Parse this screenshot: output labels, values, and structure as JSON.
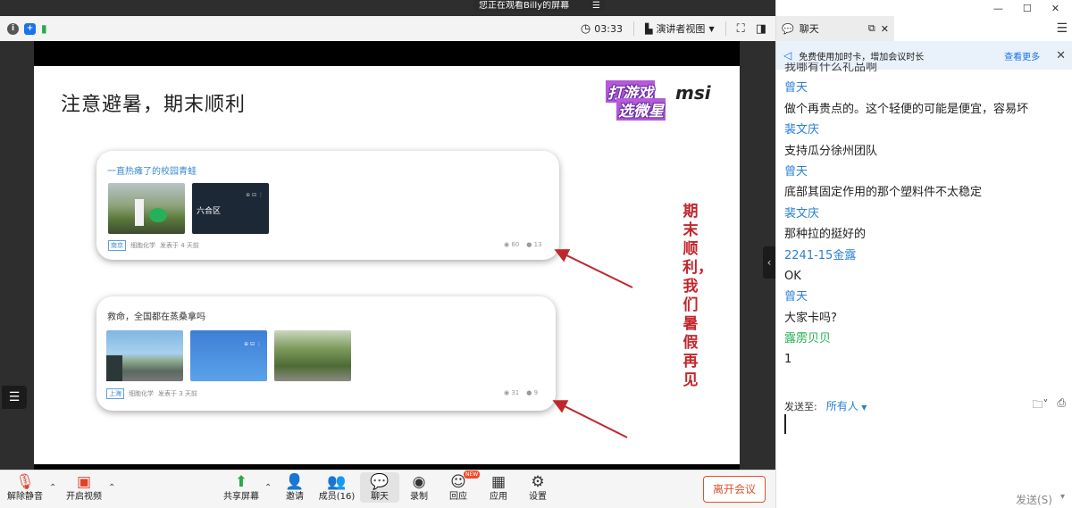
{
  "viewing_banner": "您正在观看Billy的屏幕",
  "topbar": {
    "timer": "03:33",
    "view_mode": "演讲者视图"
  },
  "slide": {
    "title": "注意避暑，期末顺利",
    "logo_game_line1": "打游戏",
    "logo_game_line2": "选微星",
    "logo_brand": "msi",
    "card1": {
      "title": "一直热瘫了的校园青蛙",
      "thumb_text": "六合区",
      "tag": "南京",
      "author": "细胞化学",
      "time": "发表于 4 天前",
      "views": "60",
      "comments": "13"
    },
    "card2": {
      "title": "救命，全国都在蒸桑拿吗",
      "tag": "上海",
      "author": "细胞化学",
      "time": "发表于 3 天前",
      "views": "31",
      "comments": "9"
    },
    "vertical_text": "期末顺利，我们暑假再见"
  },
  "toolbar": {
    "mute": "解除静音",
    "video": "开启视频",
    "share": "共享屏幕",
    "invite": "邀请",
    "members": "成员(16)",
    "chat": "聊天",
    "record": "录制",
    "reaction": "回应",
    "reaction_badge": "NEW",
    "apps": "应用",
    "settings": "设置",
    "leave": "离开会议"
  },
  "chat": {
    "tab_label": "聊天",
    "notice_text": "免费使用加时卡，增加会议时长",
    "notice_more": "查看更多",
    "messages": [
      {
        "type": "cut",
        "text": "我哪有什么礼品啊"
      },
      {
        "type": "name-blue",
        "text": "曾天"
      },
      {
        "type": "body",
        "text": "做个再贵点的。这个轻便的可能是便宜，容易坏"
      },
      {
        "type": "name-blue",
        "text": "裴文庆"
      },
      {
        "type": "body",
        "text": "支持瓜分徐州团队"
      },
      {
        "type": "name-blue",
        "text": "曾天"
      },
      {
        "type": "body",
        "text": "底部其固定作用的那个塑料件不太稳定"
      },
      {
        "type": "name-blue",
        "text": "裴文庆"
      },
      {
        "type": "body",
        "text": "那种拉的挺好的"
      },
      {
        "type": "name-blue",
        "text": "2241-15金露"
      },
      {
        "type": "body",
        "text": "OK"
      },
      {
        "type": "name-blue",
        "text": "曾天"
      },
      {
        "type": "body",
        "text": "大家卡吗?"
      },
      {
        "type": "name-green",
        "text": "露雳贝贝"
      },
      {
        "type": "body",
        "text": "1"
      }
    ],
    "send_to_label": "发送至:",
    "send_to_target": "所有人",
    "send_button": "发送(S)"
  }
}
